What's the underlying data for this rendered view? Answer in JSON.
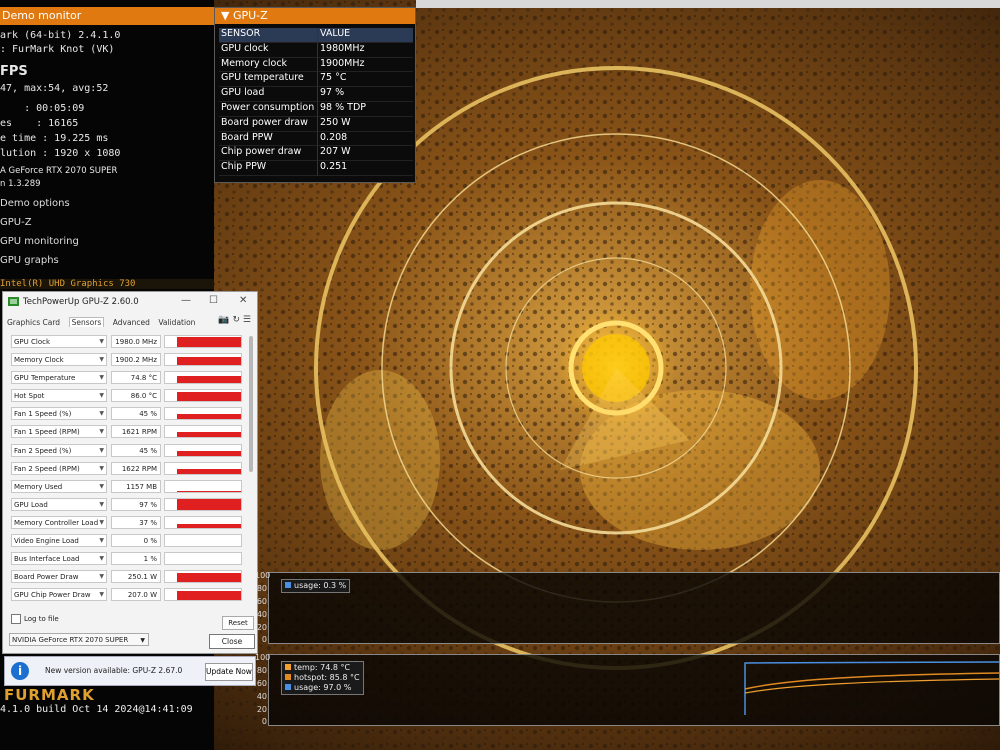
{
  "furmark": {
    "demo_monitor_title": "Demo monitor",
    "app_line": "ark (64-bit) 2.4.1.0",
    "demo_line": ": FurMark Knot (VK)",
    "fps_label": "FPS",
    "fps_stats": "47, max:54, avg:52",
    "time_line": "    : 00:05:09",
    "frames_line": "es    : 16165",
    "frame_time_line": "e time : 19.225 ms",
    "resolution_line": "lution : 1920 x 1080",
    "gpu_line": "A GeForce RTX 2070 SUPER",
    "version_line": "n 1.3.289",
    "menu": [
      "Demo options",
      "GPU-Z",
      "GPU monitoring",
      "GPU graphs"
    ],
    "intel_line": "Intel(R) UHD Graphics 730",
    "footer_brand": "FURMARK",
    "build_line": "4.1.0 build Oct 14 2024@14:41:09"
  },
  "gpuz_overlay": {
    "title": "GPU-Z",
    "headers": [
      "SENSOR",
      "VALUE"
    ],
    "rows": [
      {
        "sensor": "GPU clock",
        "value": "1980MHz"
      },
      {
        "sensor": "Memory clock",
        "value": "1900MHz"
      },
      {
        "sensor": "GPU temperature",
        "value": "75 °C"
      },
      {
        "sensor": "GPU load",
        "value": "97 %"
      },
      {
        "sensor": "Power consumption",
        "value": "98 % TDP"
      },
      {
        "sensor": "Board power draw",
        "value": "250 W"
      },
      {
        "sensor": "Board PPW",
        "value": "0.208"
      },
      {
        "sensor": "Chip power draw",
        "value": "207 W"
      },
      {
        "sensor": "Chip PPW",
        "value": "0.251"
      }
    ]
  },
  "gpuz_window": {
    "title": "TechPowerUp GPU-Z 2.60.0",
    "tabs": [
      "Graphics Card",
      "Sensors",
      "Advanced",
      "Validation"
    ],
    "active_tab": "Sensors",
    "sensors": [
      {
        "name": "GPU Clock",
        "value": "1980.0 MHz",
        "fill": 0.95
      },
      {
        "name": "Memory Clock",
        "value": "1900.2 MHz",
        "fill": 0.7
      },
      {
        "name": "GPU Temperature",
        "value": "74.8 °C",
        "fill": 0.6
      },
      {
        "name": "Hot Spot",
        "value": "86.0 °C",
        "fill": 0.8
      },
      {
        "name": "Fan 1 Speed (%)",
        "value": "45 %",
        "fill": 0.45
      },
      {
        "name": "Fan 1 Speed (RPM)",
        "value": "1621 RPM",
        "fill": 0.45
      },
      {
        "name": "Fan 2 Speed (%)",
        "value": "45 %",
        "fill": 0.45
      },
      {
        "name": "Fan 2 Speed (RPM)",
        "value": "1622 RPM",
        "fill": 0.45
      },
      {
        "name": "Memory Used",
        "value": "1157 MB",
        "fill": 0.12
      },
      {
        "name": "GPU Load",
        "value": "97 %",
        "fill": 0.97
      },
      {
        "name": "Memory Controller Load",
        "value": "37 %",
        "fill": 0.37
      },
      {
        "name": "Video Engine Load",
        "value": "0 %",
        "fill": 0
      },
      {
        "name": "Bus Interface Load",
        "value": "1 %",
        "fill": 0
      },
      {
        "name": "Board Power Draw",
        "value": "250.1 W",
        "fill": 0.85
      },
      {
        "name": "GPU Chip Power Draw",
        "value": "207.0 W",
        "fill": 0.85
      }
    ],
    "log_to_file": "Log to file",
    "reset_label": "Reset",
    "card_name": "NVIDIA GeForce RTX 2070 SUPER",
    "close_label": "Close"
  },
  "update_notice": {
    "text": "New version available: GPU-Z 2.67.0",
    "button": "Update Now"
  },
  "graphs": {
    "top": {
      "yticks": [
        "100",
        "80",
        "60",
        "40",
        "20",
        "0"
      ],
      "legend": [
        {
          "label": "usage: 0.3 %",
          "color": "#4a90e2"
        }
      ]
    },
    "bottom": {
      "yticks": [
        "100",
        "80",
        "60",
        "40",
        "20",
        "0"
      ],
      "legend": [
        {
          "label": "temp: 74.8 °C",
          "color": "#f0a030"
        },
        {
          "label": "hotspot: 85.8 °C",
          "color": "#e08a20"
        },
        {
          "label": "usage: 97.0 %",
          "color": "#4a90e2"
        }
      ]
    }
  }
}
